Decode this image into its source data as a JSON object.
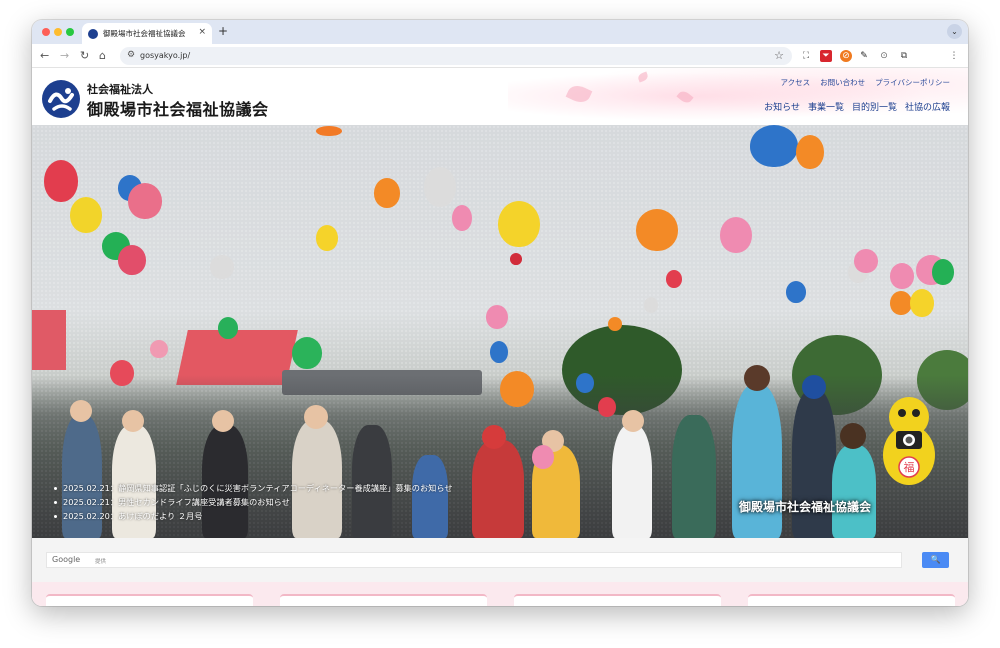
{
  "browser": {
    "tab_title": "御殿場市社会福祉協議会",
    "tab_close": "×",
    "new_tab": "+",
    "tab_menu": "⌄",
    "url": "gosyakyo.jp/",
    "nav": {
      "back": "←",
      "forward": "→",
      "reload": "↻",
      "home": "⌂"
    },
    "star": "☆",
    "menu": "⋮",
    "extensions": [
      "screen-capture-icon",
      "pdf-icon",
      "adblock-icon",
      "pen-icon",
      "camera-icon",
      "puzzle-icon"
    ]
  },
  "site": {
    "org_type": "社会福祉法人",
    "org_name": "御殿場市社会福祉協議会",
    "util_links": [
      "アクセス",
      "お問い合わせ",
      "プライバシーポリシー"
    ],
    "main_nav": [
      "お知らせ",
      "事業一覧",
      "目的別一覧",
      "社協の広報"
    ],
    "hero_caption": "御殿場市社会福祉協議会",
    "mascot_char": "福",
    "news": [
      "2025.02.21：静岡県知事認証「ふじのくに災害ボランティアコーディネーター養成講座」募集のお知らせ",
      "2025.02.21：男性セカンドライフ講座受講者募集のお知らせ",
      "2025.02.20：あけぼのだより ２月号"
    ],
    "search": {
      "brand": "Google",
      "provided": "提供",
      "button_icon": "🔍"
    }
  },
  "colors": {
    "brand_blue": "#1d3f8f",
    "search_button": "#4a8af4",
    "accent_pink": "#f2b8c6"
  }
}
